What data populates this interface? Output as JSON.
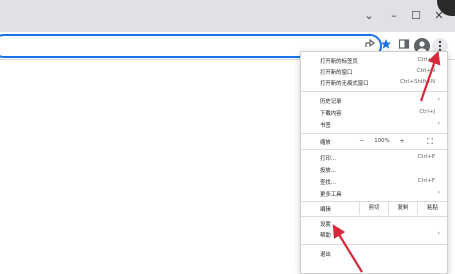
{
  "window": {
    "minimize": "⌄",
    "restore": "–",
    "maximize": "☐",
    "close": "✕"
  },
  "toolbar": {
    "share_icon": "share-icon",
    "star_icon": "star-icon",
    "panel_icon": "side-panel-icon",
    "profile_icon": "profile-icon",
    "menu_icon": "menu-icon"
  },
  "menu": {
    "new_tab": {
      "label": "打开新的标签页",
      "shortcut": "Ctrl+T"
    },
    "new_window": {
      "label": "打开新的窗口",
      "shortcut": "Ctrl+N"
    },
    "incognito": {
      "label": "打开新的无痕式窗口",
      "shortcut": "Ctrl+Shift+N"
    },
    "history": {
      "label": "历史记录"
    },
    "downloads": {
      "label": "下载内容",
      "shortcut": "Ctrl+J"
    },
    "bookmarks": {
      "label": "书签"
    },
    "zoom": {
      "label": "缩放",
      "minus": "－",
      "value": "100%",
      "plus": "+",
      "fullscreen": "⛶"
    },
    "print": {
      "label": "打印...",
      "shortcut": "Ctrl+P"
    },
    "cast": {
      "label": "投放..."
    },
    "find": {
      "label": "查找...",
      "shortcut": "Ctrl+F"
    },
    "more_tools": {
      "label": "更多工具"
    },
    "edit": {
      "label": "编辑",
      "cut": "剪切",
      "copy": "复制",
      "paste": "粘贴"
    },
    "settings": {
      "label": "设置"
    },
    "help": {
      "label": "帮助"
    },
    "exit": {
      "label": "退出"
    },
    "submenu_arrow": "›"
  },
  "colors": {
    "annotation_arrow": "#d6293b",
    "accent": "#1a73e8"
  }
}
